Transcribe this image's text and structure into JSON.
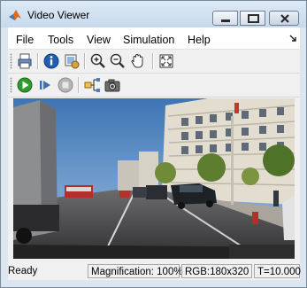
{
  "window": {
    "title": "Video Viewer"
  },
  "menu": {
    "items": [
      "File",
      "Tools",
      "View",
      "Simulation",
      "Help"
    ]
  },
  "toolbar1": {
    "buttons": [
      "print-icon",
      "info-icon",
      "zoom-settings-icon",
      "zoom-in-icon",
      "zoom-out-icon",
      "pan-hand-icon",
      "fit-to-window-icon"
    ]
  },
  "toolbar2": {
    "buttons": [
      "play-icon",
      "step-forward-icon",
      "stop-icon",
      "highlight-signal-icon",
      "snapshot-camera-icon"
    ]
  },
  "video": {
    "content": "dashcam-street-scene"
  },
  "status": {
    "state": "Ready",
    "magnification": "Magnification: 100%",
    "format": "RGB:180x320",
    "time": "T=10.000"
  },
  "colors": {
    "titlebar": "#c9dcee",
    "play_green": "#2e9d2e",
    "info_blue": "#1f5fb0"
  }
}
